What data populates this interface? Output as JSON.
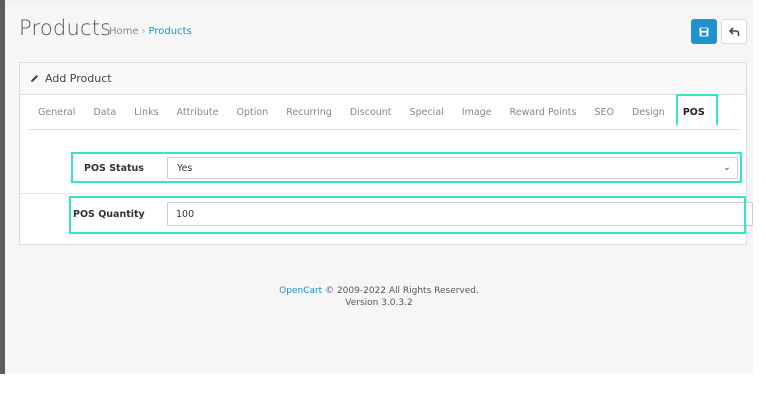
{
  "header": {
    "title": "Products",
    "breadcrumb": {
      "home": "Home",
      "separator": "›",
      "current": "Products"
    }
  },
  "toolbar": {
    "save_icon": "save-icon",
    "back_icon": "back-arrow-icon"
  },
  "panel": {
    "heading": "Add Product",
    "tabs": [
      "General",
      "Data",
      "Links",
      "Attribute",
      "Option",
      "Recurring",
      "Discount",
      "Special",
      "Image",
      "Reward Points",
      "SEO",
      "Design",
      "POS"
    ],
    "active_tab": "POS"
  },
  "form": {
    "pos_status": {
      "label": "POS Status",
      "value": "Yes"
    },
    "pos_quantity": {
      "label": "POS Quantity",
      "value": "100"
    }
  },
  "footer": {
    "brand": "OpenCart",
    "copyright": "© 2009-2022 All Rights Reserved.",
    "version": "Version 3.0.3.2"
  },
  "colors": {
    "accent": "#1e91cf",
    "highlight": "#2ee8c6"
  }
}
